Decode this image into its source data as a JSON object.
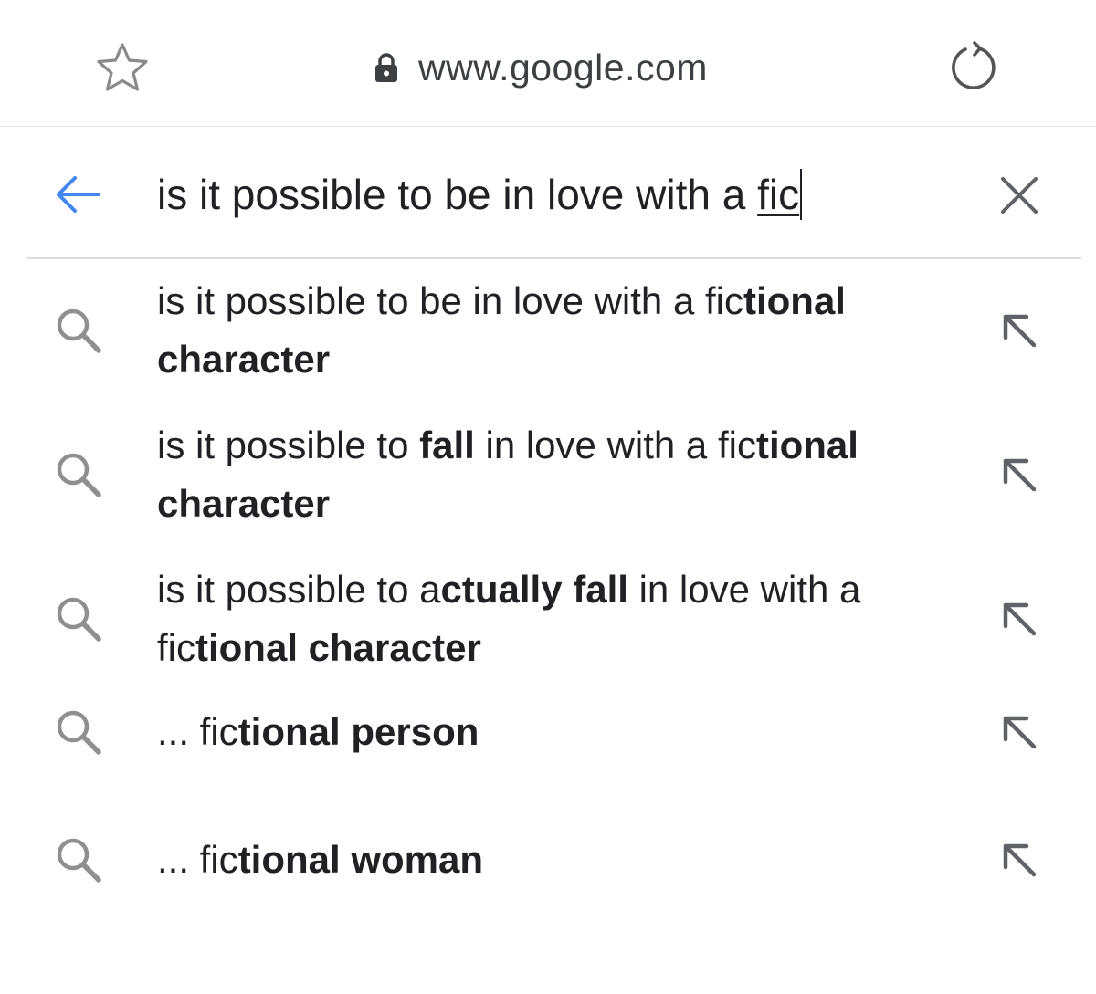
{
  "address_bar": {
    "url": "www.google.com",
    "star_icon": "star-outline-icon",
    "lock_icon": "lock-icon",
    "reload_icon": "reload-icon"
  },
  "search": {
    "query_prefix": "is it possible to be in love with a ",
    "query_typed": "fic",
    "back_icon": "arrow-back-icon",
    "clear_icon": "close-icon",
    "accent_color": "#4285f4"
  },
  "suggestions": [
    {
      "parts": [
        {
          "text": "is it possible to be in love with a fic",
          "bold": false
        },
        {
          "text": "tional character",
          "bold": true
        }
      ]
    },
    {
      "parts": [
        {
          "text": "is it possible to ",
          "bold": false
        },
        {
          "text": "fall",
          "bold": true
        },
        {
          "text": " in love with a fic",
          "bold": false
        },
        {
          "text": "tional character",
          "bold": true
        }
      ]
    },
    {
      "parts": [
        {
          "text": "is it possible to a",
          "bold": false
        },
        {
          "text": "ctually fall",
          "bold": true
        },
        {
          "text": " in love with a fic",
          "bold": false
        },
        {
          "text": "tional character",
          "bold": true
        }
      ]
    },
    {
      "parts": [
        {
          "text": "... fic",
          "bold": false
        },
        {
          "text": "tional person",
          "bold": true
        }
      ]
    },
    {
      "parts": [
        {
          "text": "... fic",
          "bold": false
        },
        {
          "text": "tional woman",
          "bold": true
        }
      ]
    }
  ]
}
